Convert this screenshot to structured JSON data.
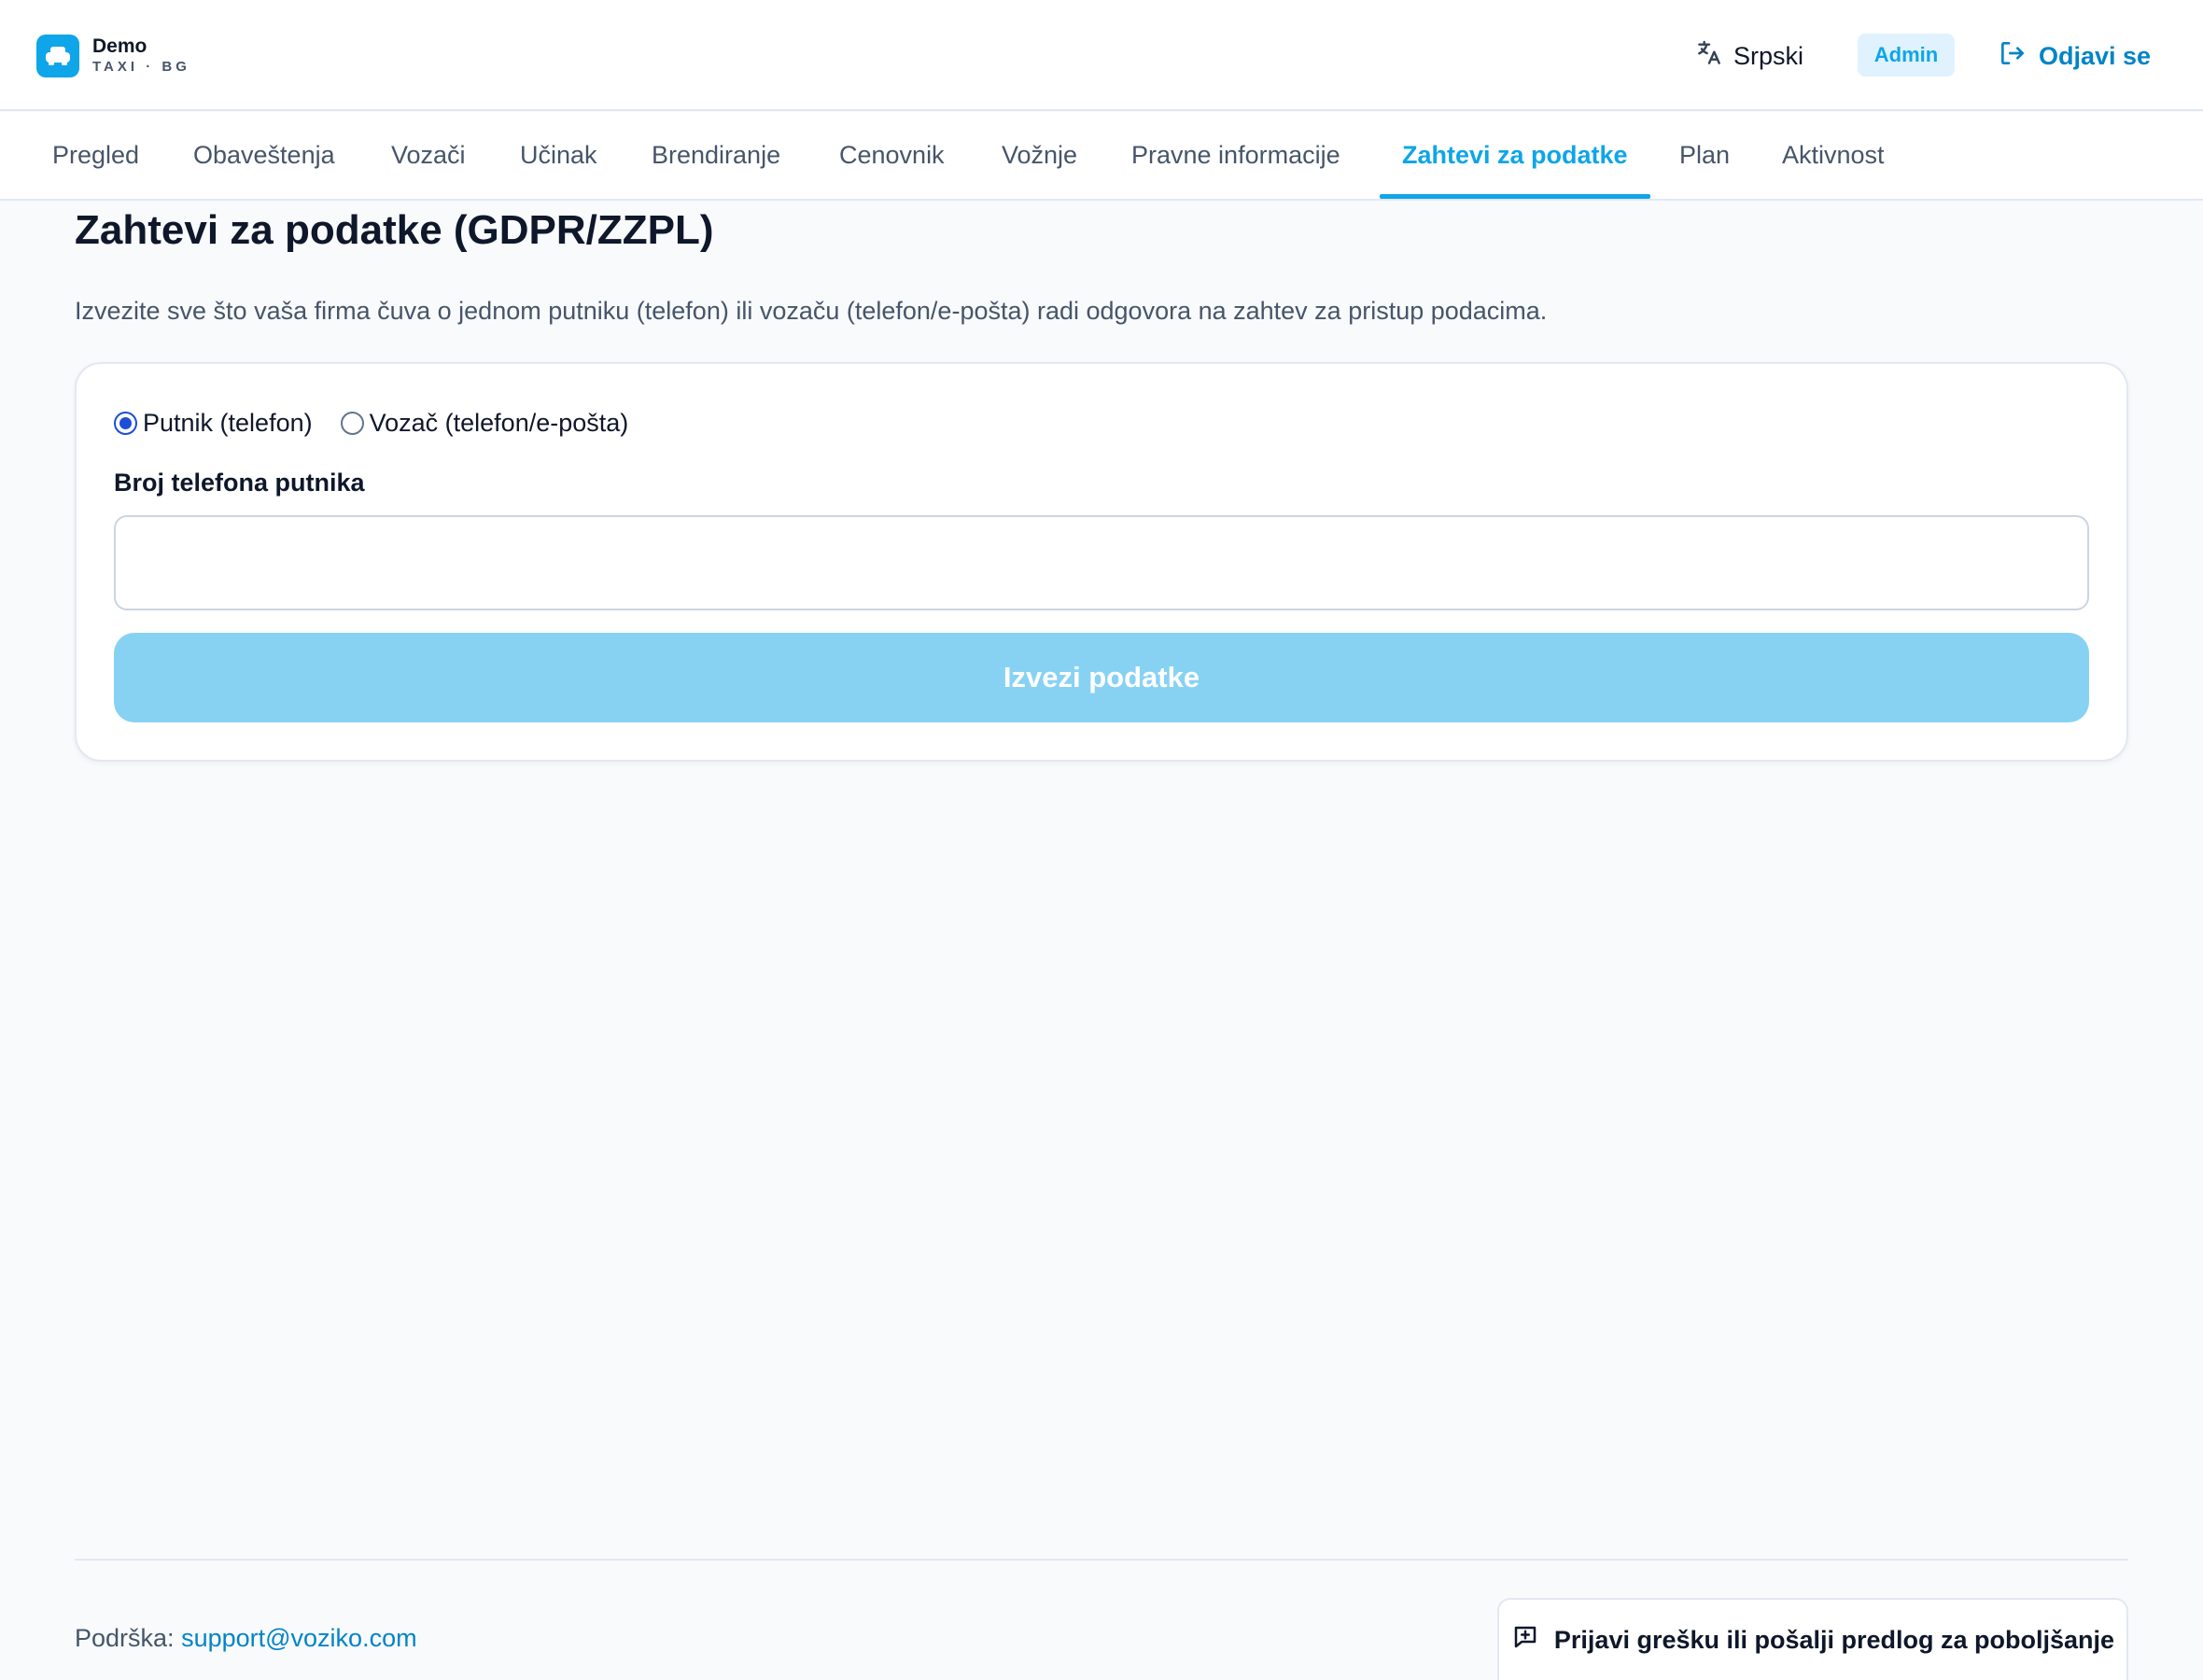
{
  "header": {
    "brand_name": "Demo",
    "brand_sub": "TAXI · BG",
    "language_label": "Srpski",
    "role_badge": "Admin",
    "logout_label": "Odjavi se"
  },
  "tabs": [
    {
      "label": "Pregled",
      "active": false
    },
    {
      "label": "Obaveštenja",
      "active": false
    },
    {
      "label": "Vozači",
      "active": false
    },
    {
      "label": "Učinak",
      "active": false
    },
    {
      "label": "Brendiranje",
      "active": false
    },
    {
      "label": "Cenovnik",
      "active": false
    },
    {
      "label": "Vožnje",
      "active": false
    },
    {
      "label": "Pravne informacije",
      "active": false
    },
    {
      "label": "Zahtevi za podatke",
      "active": true
    },
    {
      "label": "Plan",
      "active": false
    },
    {
      "label": "Aktivnost",
      "active": false
    }
  ],
  "page": {
    "title": "Zahtevi za podatke (GDPR/ZZPL)",
    "description": "Izvezite sve što vaša firma čuva o jednom putniku (telefon) ili vozaču (telefon/e-pošta) radi odgovora na zahtev za pristup podacima."
  },
  "form": {
    "radio_options": [
      {
        "label": "Putnik (telefon)",
        "checked": true
      },
      {
        "label": "Vozač (telefon/e-pošta)",
        "checked": false
      }
    ],
    "field_label": "Broj telefona putnika",
    "phone_value": "",
    "export_button": "Izvezi podatke"
  },
  "footer": {
    "support_prefix": "Podrška:",
    "support_email": "support@voziko.com",
    "feedback_button": "Prijavi grešku ili pošalji predlog za poboljšanje"
  },
  "colors": {
    "accent": "#0ea5e9",
    "accent_dark": "#0284c7",
    "button_disabled": "#87d2f3",
    "background": "#f8fafc"
  },
  "icons": {
    "logo": "car-icon",
    "language": "translate-icon",
    "logout": "logout-icon",
    "feedback": "message-plus-icon"
  }
}
